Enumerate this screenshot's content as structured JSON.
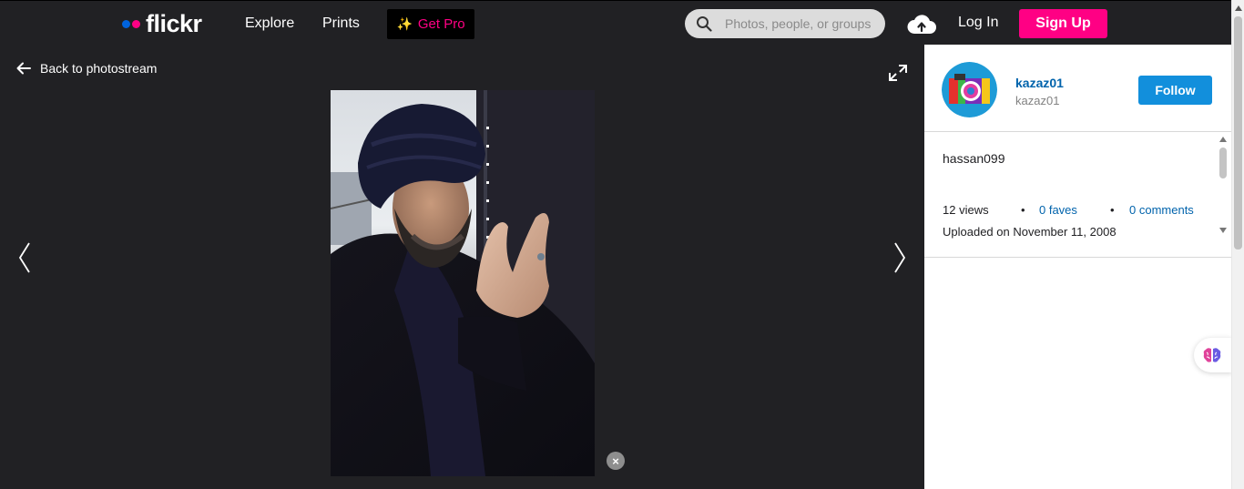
{
  "header": {
    "logo_text": "flickr",
    "nav": {
      "explore": "Explore",
      "prints": "Prints"
    },
    "get_pro": "Get Pro",
    "search_placeholder": "Photos, people, or groups",
    "login": "Log In",
    "signup": "Sign Up"
  },
  "viewer": {
    "back_label": "Back to photostream",
    "close_label": "×"
  },
  "owner": {
    "name": "kazaz01",
    "username": "kazaz01",
    "follow_label": "Follow"
  },
  "photo": {
    "title": "hassan099",
    "views": "12 views",
    "faves": "0 faves",
    "comments": "0 comments",
    "uploaded": "Uploaded on November 11, 2008"
  },
  "colors": {
    "brand_blue": "#0063dc",
    "brand_pink": "#ff0084",
    "follow_blue": "#128fdc",
    "dark_bg": "#212124"
  }
}
